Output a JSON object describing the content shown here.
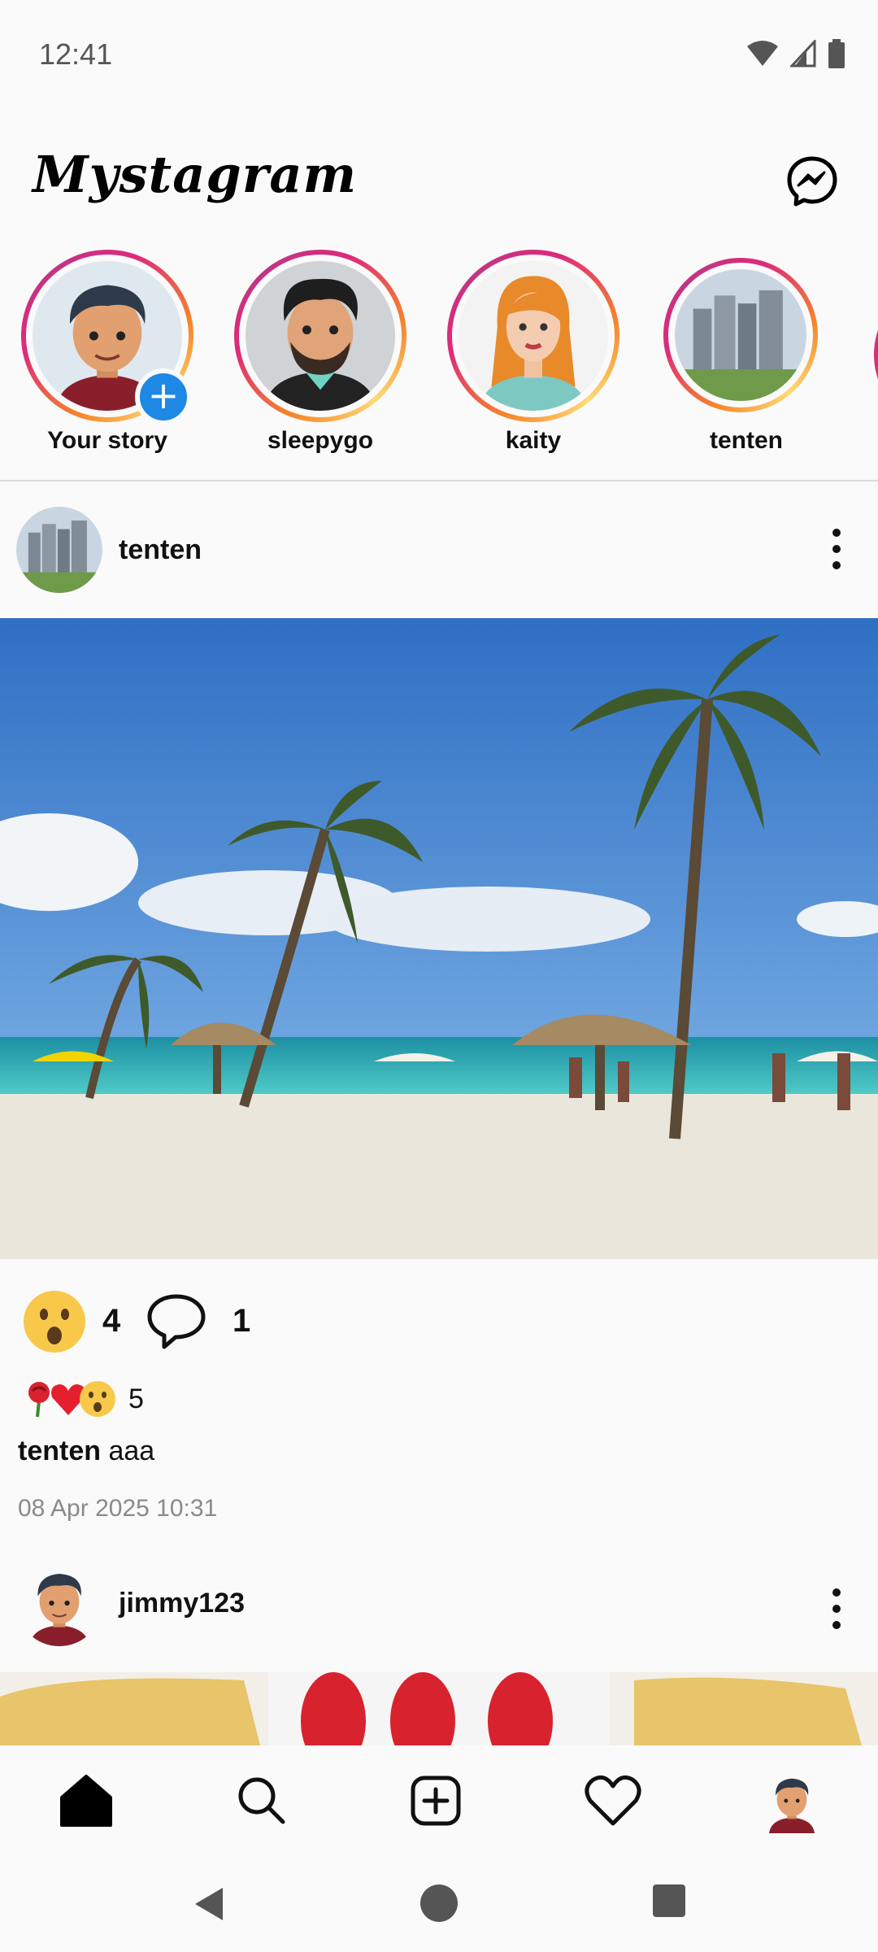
{
  "status_bar": {
    "time": "12:41"
  },
  "header": {
    "title": "Mystagram"
  },
  "stories": [
    {
      "label": "Your story",
      "avatar": "boy-avatar",
      "has_add": true
    },
    {
      "label": "sleepygo",
      "avatar": "bearded-man-avatar"
    },
    {
      "label": "kaity",
      "avatar": "redhead-woman-avatar"
    },
    {
      "label": "tenten",
      "avatar": "city-buildings-photo"
    }
  ],
  "posts": [
    {
      "username": "tenten",
      "avatar": "city-buildings-photo",
      "image": "beach-palm-trees-photo",
      "reaction_emoji": "😯",
      "reaction_count": "4",
      "comment_count": "1",
      "reactions_summary": {
        "emojis": [
          "🌹",
          "❤️",
          "😯"
        ],
        "count": "5"
      },
      "caption_user": "tenten",
      "caption_text": "aaa",
      "timestamp": "08 Apr 2025 10:31"
    },
    {
      "username": "jimmy123",
      "avatar": "boy-avatar",
      "image": "fries-photo"
    }
  ],
  "bottom_nav": [
    "home-icon",
    "search-icon",
    "add-post-icon",
    "heart-icon",
    "profile-avatar"
  ],
  "colors": {
    "accent": "#1e88e5",
    "story_ring": "#dd2a7b",
    "background": "#fafafa"
  }
}
